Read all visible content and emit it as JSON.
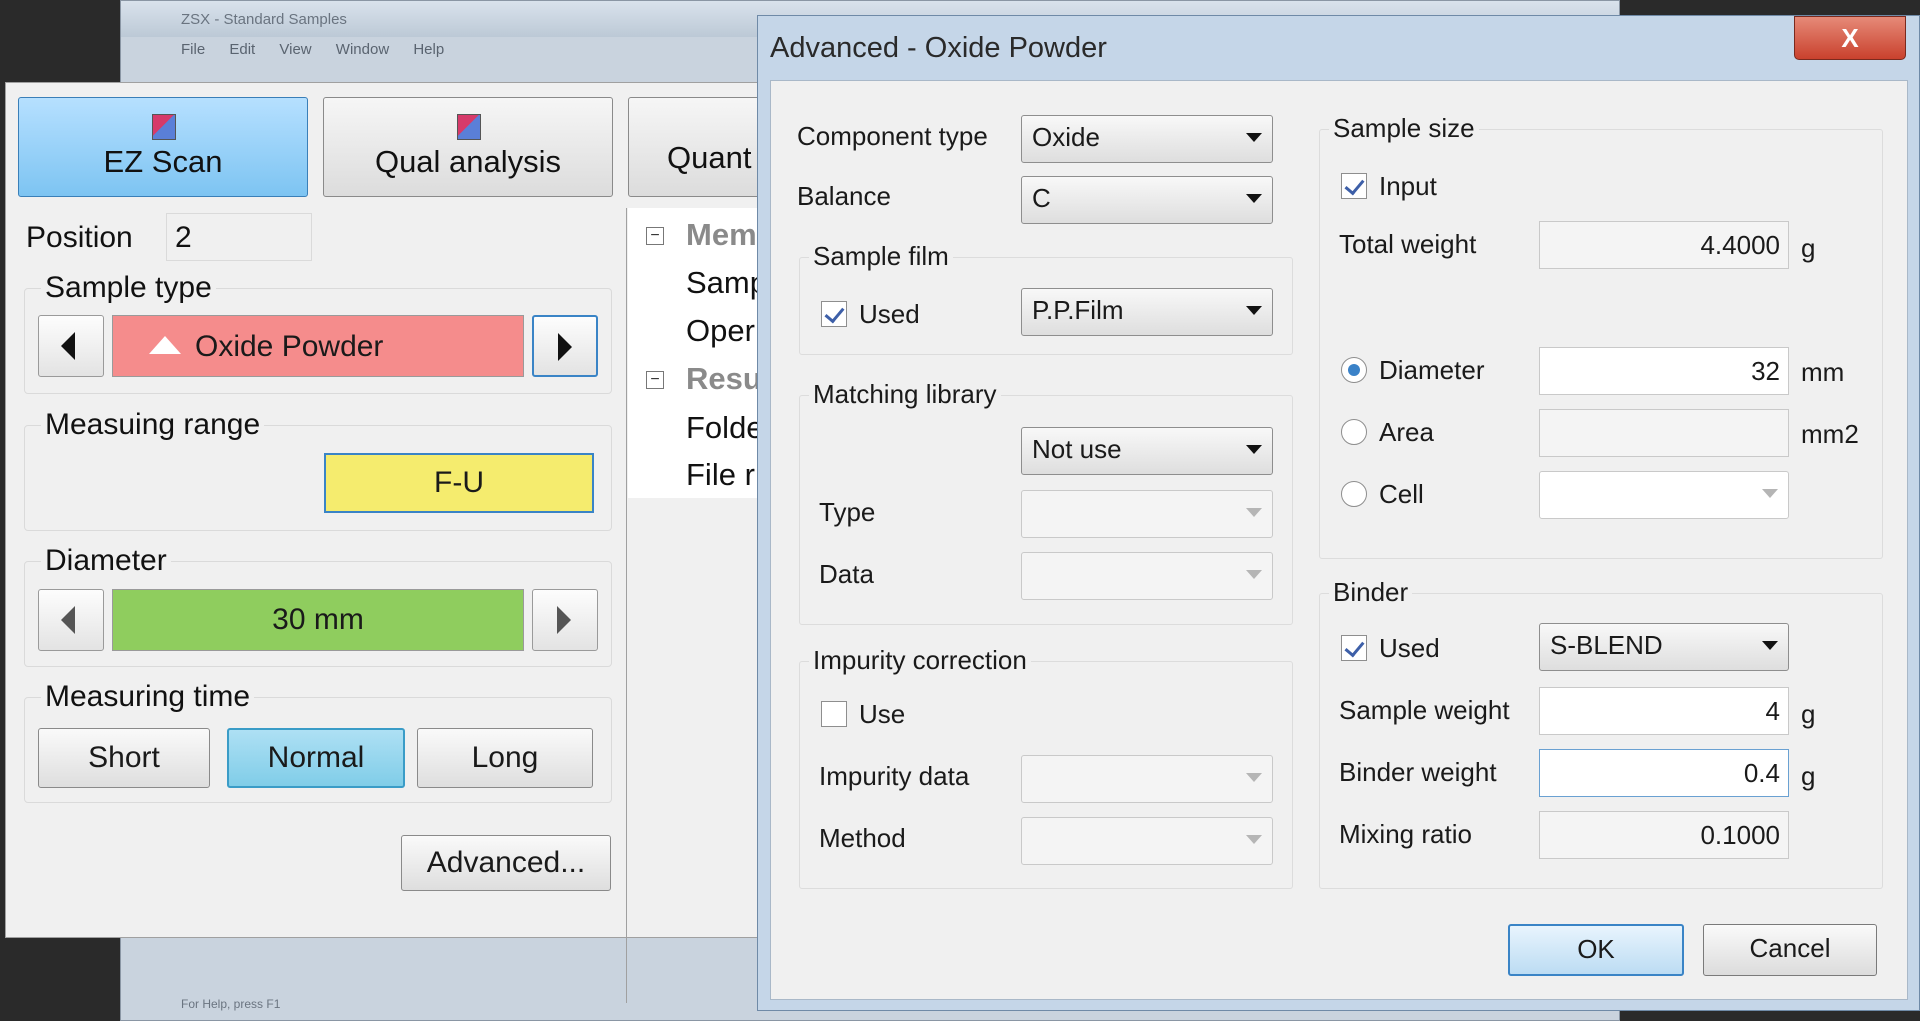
{
  "background_window": {
    "title": "ZSX - Standard Samples",
    "menu": [
      "File",
      "Edit",
      "View",
      "Window",
      "Help"
    ],
    "status": "For Help, press F1"
  },
  "left_panel": {
    "tabs": [
      {
        "label": "EZ Scan"
      },
      {
        "label": "Qual analysis"
      },
      {
        "label": "Quant"
      }
    ],
    "position": {
      "label": "Position",
      "value": "2"
    },
    "sample_type": {
      "label": "Sample type",
      "value": "Oxide Powder"
    },
    "measuring_range": {
      "label": "Measuing range",
      "value": "F-U"
    },
    "diameter": {
      "label": "Diameter",
      "value": "30 mm"
    },
    "measuring_time": {
      "label": "Measuring time",
      "options": [
        "Short",
        "Normal",
        "Long"
      ],
      "selected": "Normal"
    },
    "advanced_button": "Advanced...",
    "tree": {
      "section1": "Mem",
      "section1_items": [
        "Samp",
        "Oper"
      ],
      "section2": "Resu",
      "section2_items": [
        "Folde",
        "File r"
      ]
    }
  },
  "dialog": {
    "title": "Advanced - Oxide Powder",
    "component_type": {
      "label": "Component type",
      "value": "Oxide"
    },
    "balance": {
      "label": "Balance",
      "value": "C"
    },
    "sample_film": {
      "title": "Sample film",
      "used_label": "Used",
      "used_checked": true,
      "value": "P.P.Film"
    },
    "matching_library": {
      "title": "Matching library",
      "value": "Not use",
      "type_label": "Type",
      "data_label": "Data"
    },
    "impurity_correction": {
      "title": "Impurity correction",
      "use_label": "Use",
      "use_checked": false,
      "data_label": "Impurity data",
      "method_label": "Method"
    },
    "sample_size": {
      "title": "Sample size",
      "input_label": "Input",
      "input_checked": true,
      "total_weight_label": "Total weight",
      "total_weight": "4.4000",
      "total_weight_unit": "g",
      "diameter_label": "Diameter",
      "diameter_value": "32",
      "diameter_unit": "mm",
      "area_label": "Area",
      "area_unit": "mm2",
      "cell_label": "Cell",
      "selected": "Diameter"
    },
    "binder": {
      "title": "Binder",
      "used_label": "Used",
      "used_checked": true,
      "value": "S-BLEND",
      "sample_weight_label": "Sample weight",
      "sample_weight": "4",
      "sample_weight_unit": "g",
      "binder_weight_label": "Binder weight",
      "binder_weight": "0.4",
      "binder_weight_unit": "g",
      "mixing_ratio_label": "Mixing ratio",
      "mixing_ratio": "0.1000"
    },
    "ok_label": "OK",
    "cancel_label": "Cancel",
    "close_glyph": "X"
  },
  "colors": {
    "sample_type_bar": "#f58c8c",
    "measuring_range_bar": "#f5ec6e",
    "diameter_bar": "#8fcd5e",
    "selected_button": "#80cde8"
  }
}
